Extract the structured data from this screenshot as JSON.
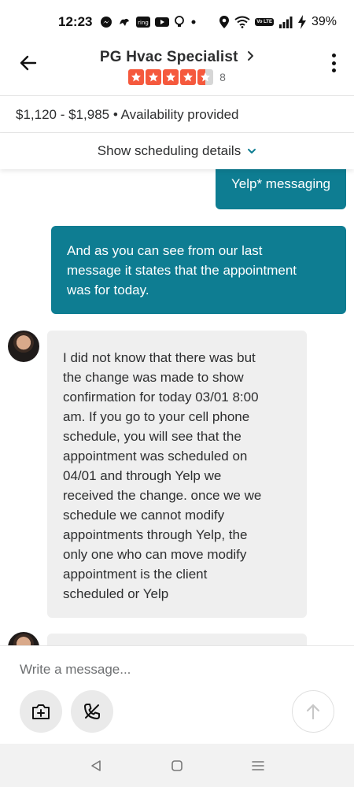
{
  "status_bar": {
    "time": "12:23",
    "left_icons": [
      "messenger-icon",
      "fetch-icon",
      "ring-icon",
      "youtube-icon",
      "lightbulb-icon",
      "dot-icon"
    ],
    "right_icons": [
      "location-icon",
      "wifi-icon",
      "volte-icon",
      "signal-icon",
      "charging-icon"
    ],
    "volte_label": "Vo LTE",
    "battery": "39%"
  },
  "header": {
    "business_name": "PG Hvac Specialist",
    "rating": 4.5,
    "review_count": "8",
    "star_color": "#f5593d"
  },
  "quote": {
    "price_line": "$1,120 - $1,985 • Availability provided",
    "scheduling_toggle": "Show scheduling details"
  },
  "messages": [
    {
      "from": "me",
      "text": "Yelp* messaging"
    },
    {
      "from": "me",
      "lines": [
        "And as you can see from our last",
        "message it states that the appointment",
        "was for today."
      ]
    },
    {
      "from": "business",
      "lines": [
        "I did not know that there was but",
        "the change was made to show",
        "confirmation for today 03/01 8:00",
        "am.  If you go to your cell phone",
        "schedule, you will see that the",
        "appointment was scheduled on",
        "04/01 and through Yelp we",
        "received the change.  once we  we",
        "schedule we cannot modify",
        "appointments through Yelp, the",
        "only one who can move modify",
        "appointment is the client",
        "scheduled or Yelp"
      ]
    }
  ],
  "composer": {
    "placeholder": "Write a message..."
  },
  "colors": {
    "outgoing_bubble": "#0e7d92",
    "incoming_bubble": "#efefef",
    "accent_blue": "#0e7d92"
  }
}
